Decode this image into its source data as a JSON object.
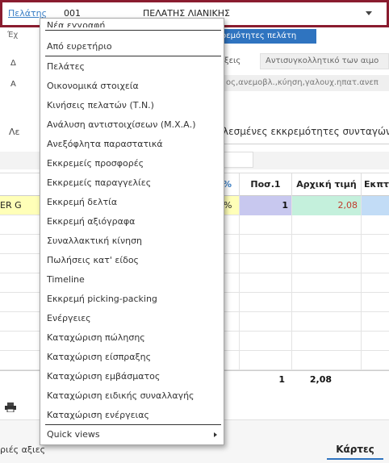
{
  "customer_bar": {
    "link_label": "Πελάτης",
    "code": "001",
    "name": "ΠΕΛΑΤΗΣ ΛΙΑΝΙΚΗΣ"
  },
  "background": {
    "row_ex": "Έχ",
    "pending_btn": "κρεμότητες πελάτη",
    "label_d": "Δ",
    "label_a": "Α",
    "label_l": "Λε",
    "field_eis": "ξεις",
    "anti_value": "Αντισυγκολλητικό των αιμο",
    "tags_value": "ος,ανεμοβλ.,κύηση,γαλουχ.ηπατ.ανεπ",
    "pending_orders": "λεσμένες εκκρεμότητες συνταγών"
  },
  "grid": {
    "pct_header": "%",
    "headers": {
      "qty": "Ποσ.1",
      "price": "Αρχική τιμή",
      "disc": "Εκπτ"
    },
    "selected_row": {
      "left": "ER G",
      "pct": "%",
      "qty": "1",
      "price": "2,08"
    },
    "totals": {
      "qty": "1",
      "price": "2,08"
    }
  },
  "bottom": {
    "left_text": "ριές αξιες",
    "tab": "Κάρτες"
  },
  "menu": {
    "top_partial": "Νέα εγγραφή",
    "items": [
      "Από ευρετήριο",
      "Πελάτες",
      "Οικονομικά στοιχεία",
      "Κινήσεις πελατών (Τ.Ν.)",
      "Ανάλυση αντιστοιχίσεων (Μ.Χ.Α.)",
      "Ανεξόφλητα παραστατικά",
      "Εκκρεμείς προσφορές",
      "Εκκρεμείς παραγγελίες",
      "Εκκρεμή δελτία",
      "Εκκρεμή αξιόγραφα",
      "Συναλλακτική κίνηση",
      "Πωλήσεις κατ' είδος",
      "Timeline",
      "Εκκρεμή picking-packing",
      "Ενέργειες",
      "Καταχώριση πώλησης",
      "Καταχώριση είσπραξης",
      "Καταχώριση εμβάσματος",
      "Καταχώριση ειδικής συναλλαγής",
      "Καταχώριση ενέργειας",
      "Quick views"
    ]
  },
  "colors": {
    "highlight_border": "#8a1c2f",
    "accent": "#2f74c0",
    "row_selected": "#ffffb8",
    "price_text": "#c0392b"
  }
}
